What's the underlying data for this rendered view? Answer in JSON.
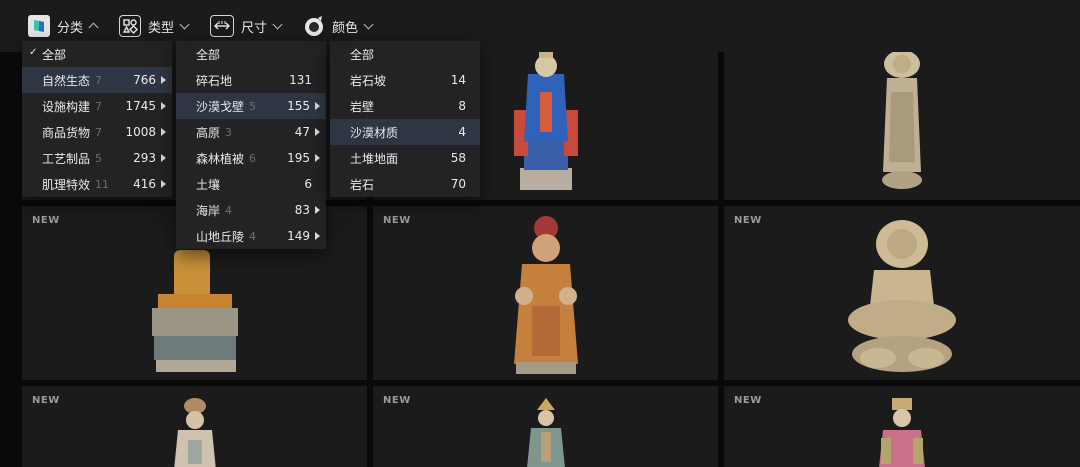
{
  "toolbar": {
    "items": [
      {
        "label": "分类",
        "icon": "category-icon",
        "open": true
      },
      {
        "label": "类型",
        "icon": "type-icon",
        "open": false
      },
      {
        "label": "尺寸",
        "icon": "size-icon",
        "open": false
      },
      {
        "label": "颜色",
        "icon": "color-icon",
        "open": false
      }
    ]
  },
  "menus": {
    "level1": [
      {
        "label": "全部",
        "checked": true
      },
      {
        "label": "自然生态",
        "sub": "7",
        "count": "766",
        "arrow": true,
        "highlight": true
      },
      {
        "label": "设施构建",
        "sub": "7",
        "count": "1745",
        "arrow": true
      },
      {
        "label": "商品货物",
        "sub": "7",
        "count": "1008",
        "arrow": true
      },
      {
        "label": "工艺制品",
        "sub": "5",
        "count": "293",
        "arrow": true
      },
      {
        "label": "肌理特效",
        "sub": "11",
        "count": "416",
        "arrow": true
      }
    ],
    "level2": [
      {
        "label": "全部",
        "header": true
      },
      {
        "label": "碎石地",
        "count": "131"
      },
      {
        "label": "沙漠戈壁",
        "sub": "5",
        "count": "155",
        "arrow": true,
        "highlight": true
      },
      {
        "label": "高原",
        "sub": "3",
        "count": "47",
        "arrow": true
      },
      {
        "label": "森林植被",
        "sub": "6",
        "count": "195",
        "arrow": true
      },
      {
        "label": "土壤",
        "count": "6"
      },
      {
        "label": "海岸",
        "sub": "4",
        "count": "83",
        "arrow": true
      },
      {
        "label": "山地丘陵",
        "sub": "4",
        "count": "149",
        "arrow": true
      }
    ],
    "level3": [
      {
        "label": "全部",
        "header": true
      },
      {
        "label": "岩石坡",
        "count": "14"
      },
      {
        "label": "岩壁",
        "count": "8"
      },
      {
        "label": "沙漠材质",
        "count": "4",
        "highlight": true
      },
      {
        "label": "土堆地面",
        "count": "58"
      },
      {
        "label": "岩石",
        "count": "70"
      }
    ]
  },
  "cards": {
    "badge": "NEW"
  },
  "colors": {
    "background": "#0a0a0b",
    "toolbar": "#1b1b1d",
    "card": "#1b1b1c",
    "menu": "#232326",
    "menu_highlight": "#2f3643"
  }
}
